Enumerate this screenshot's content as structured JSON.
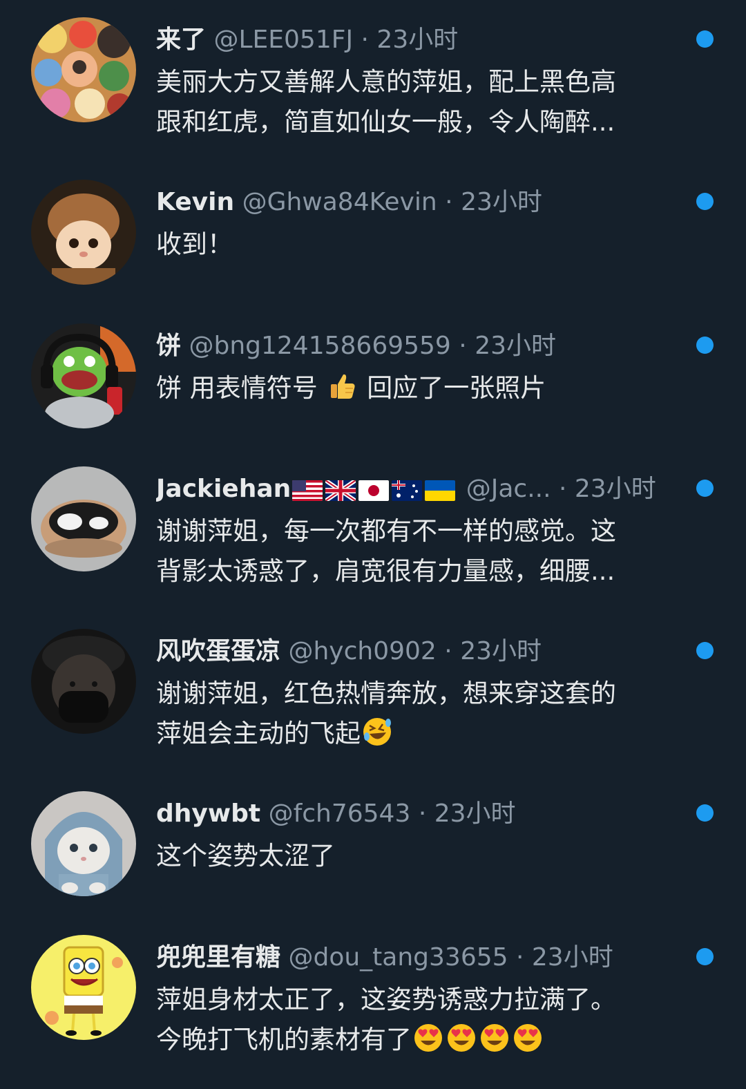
{
  "replies": [
    {
      "name": "来了",
      "handle": "@LEE051FJ",
      "dot": "·",
      "time": "23小时",
      "text_lines": [
        "美丽大方又善解人意的萍姐，配上黑色高",
        "跟和红虎，简直如仙女一般，令人陶醉..."
      ],
      "avatar": "anime-collage-avatar"
    },
    {
      "name": "Kevin",
      "handle": "@Ghwa84Kevin",
      "dot": "·",
      "time": "23小时",
      "text_lines": [
        "收到！"
      ],
      "avatar": "cartoon-character-hat-avatar"
    },
    {
      "name": "饼",
      "handle": "@bng124158669559",
      "dot": "·",
      "time": "23小时",
      "text_before": "饼 用表情符号",
      "text_after": "回应了一张照片",
      "emoji": "thumbs-up",
      "avatar": "frog-headphones-avatar"
    },
    {
      "name": "Jackiehan",
      "flags": [
        "us",
        "uk",
        "jp",
        "au",
        "ua"
      ],
      "handle": "@Jac...",
      "dot": "·",
      "time": "23小时",
      "text_lines": [
        "谢谢萍姐，每一次都有不一样的感觉。这",
        "背影太诱惑了，肩宽很有力量感，细腰..."
      ],
      "avatar": "black-white-cat-avatar"
    },
    {
      "name": "风吹蛋蛋凉",
      "handle": "@hych0902",
      "dot": "·",
      "time": "23小时",
      "text_lines": [
        "谢谢萍姐，红色热情奔放，想来穿这套的",
        "萍姐会主动的飞起"
      ],
      "line2_emoji": "rofl",
      "avatar": "masked-person-avatar"
    },
    {
      "name": "dhywbt",
      "handle": "@fch76543",
      "dot": "·",
      "time": "23小时",
      "text_lines": [
        "这个姿势太涩了"
      ],
      "avatar": "cat-hoodie-avatar"
    },
    {
      "name": "兜兜里有糖",
      "handle": "@dou_tang33655",
      "dot": "·",
      "time": "23小时",
      "text_lines": [
        "萍姐身材太正了，这姿势诱惑力拉满了。",
        "今晚打飞机的素材有了"
      ],
      "line2_emojis": [
        "heart-eyes",
        "heart-eyes",
        "heart-eyes",
        "heart-eyes"
      ],
      "avatar": "sponge-character-avatar"
    }
  ],
  "colors": {
    "background": "#15202b",
    "text": "#e7e9ea",
    "secondary": "#8b98a5",
    "unread_dot": "#1d9bf0"
  }
}
